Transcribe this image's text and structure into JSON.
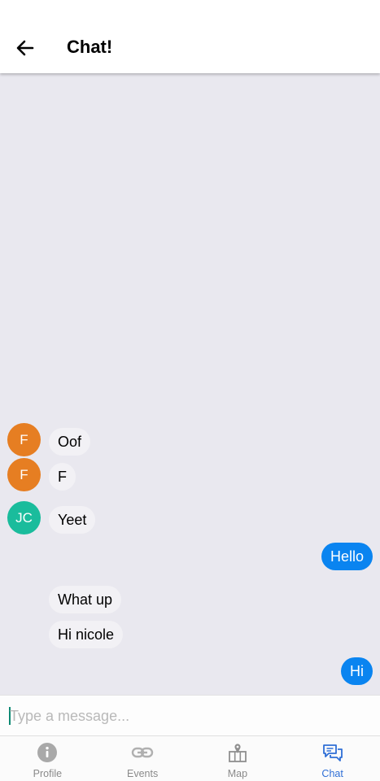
{
  "header": {
    "title": "Chat!"
  },
  "messages": [
    {
      "avatar": "F",
      "avatar_color": "#e67e22",
      "text": "Oof"
    },
    {
      "avatar": "F",
      "avatar_color": "#e67e22",
      "text": "F"
    },
    {
      "avatar": "JC",
      "avatar_color": "#1abc9c",
      "text": "Yeet"
    },
    {
      "text": "Hello",
      "outgoing": true
    },
    {
      "text": "What up"
    },
    {
      "text": "Hi nicole"
    },
    {
      "text": "Hi",
      "outgoing": true
    }
  ],
  "composer": {
    "placeholder": "Type a message..."
  },
  "tabs": [
    {
      "label": "Profile",
      "icon": "info-icon"
    },
    {
      "label": "Events",
      "icon": "link-icon"
    },
    {
      "label": "Map",
      "icon": "map-icon"
    },
    {
      "label": "Chat",
      "icon": "chat-icon",
      "active": true
    }
  ],
  "colors": {
    "outgoing_bubble": "#0a84f0",
    "incoming_bubble": "#f2f1f5",
    "chat_background": "#e9e8ef",
    "active_tab": "#2f6fd6",
    "inactive_tab": "#8a8a8a"
  }
}
